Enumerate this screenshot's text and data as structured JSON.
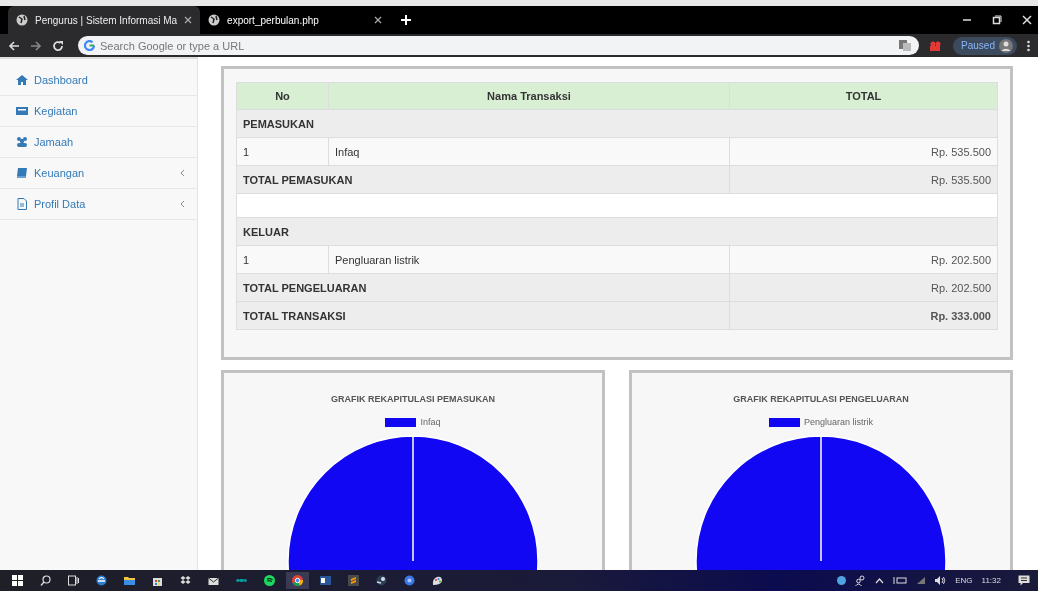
{
  "browser": {
    "tabs": [
      {
        "title": "Pengurus | Sistem Informasi Ma",
        "selected": true
      },
      {
        "title": "export_perbulan.php",
        "selected": false
      }
    ],
    "address": {
      "placeholder": "Search Google or type a URL"
    },
    "profile": "Paused"
  },
  "sidebar": {
    "items": [
      {
        "label": "Dashboard",
        "expandable": false
      },
      {
        "label": "Kegiatan",
        "expandable": false
      },
      {
        "label": "Jamaah",
        "expandable": false
      },
      {
        "label": "Keuangan",
        "expandable": true
      },
      {
        "label": "Profil Data",
        "expandable": true
      }
    ]
  },
  "table": {
    "columns": [
      "No",
      "Nama Transaksi",
      "TOTAL"
    ],
    "rows": [
      {
        "kind": "section",
        "label": "PEMASUKAN"
      },
      {
        "kind": "item",
        "no": "1",
        "name": "Infaq",
        "total": "Rp. 535.500"
      },
      {
        "kind": "total",
        "label": "TOTAL PEMASUKAN",
        "total": "Rp. 535.500"
      },
      {
        "kind": "blank"
      },
      {
        "kind": "section",
        "label": "KELUAR"
      },
      {
        "kind": "item",
        "no": "1",
        "name": "Pengluaran listrik",
        "total": "Rp. 202.500"
      },
      {
        "kind": "total",
        "label": "TOTAL PENGELUARAN",
        "total": "Rp. 202.500"
      },
      {
        "kind": "grand",
        "label": "TOTAL TRANSAKSI",
        "total": "Rp. 333.000"
      }
    ]
  },
  "charts": [
    {
      "title": "GRAFIK REKAPITULASI PEMASUKAN",
      "legend": [
        {
          "label": "Infaq",
          "color": "#1207f2"
        }
      ]
    },
    {
      "title": "GRAFIK REKAPITULASI PENGELUARAN",
      "legend": [
        {
          "label": "Pengluaran listrik",
          "color": "#1207f2"
        }
      ]
    }
  ],
  "taskbar": {
    "language": "ENG",
    "time": "11:32"
  }
}
